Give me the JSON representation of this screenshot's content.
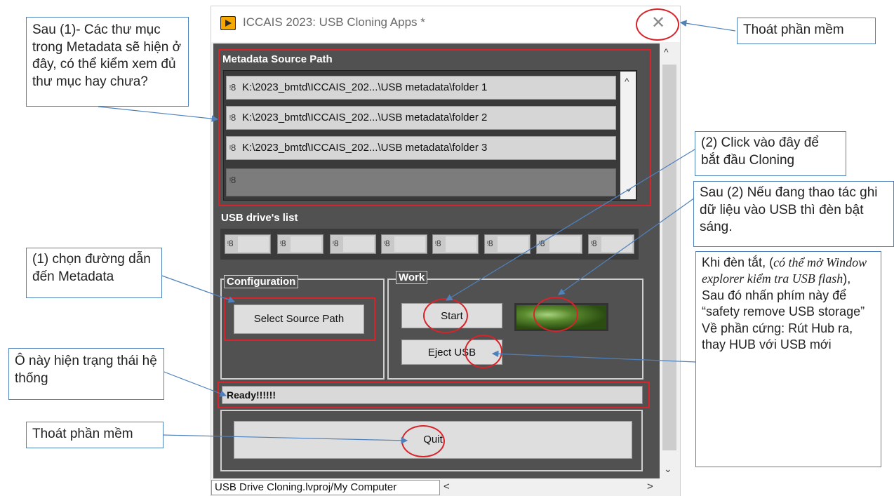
{
  "window": {
    "title": "ICCAIS 2023: USB Cloning Apps *",
    "close_glyph": "✕",
    "scroll_up": "^",
    "scroll_down": "⌄",
    "project_label": "USB Drive Cloning.lvproj/My Computer",
    "hscroll_left": "<",
    "hscroll_right": ">"
  },
  "metadata": {
    "label": "Metadata Source Path",
    "paths": [
      "K:\\2023_bmtd\\ICCAIS_202...\\USB metadata\\folder 1",
      "K:\\2023_bmtd\\ICCAIS_202...\\USB metadata\\folder 2",
      "K:\\2023_bmtd\\ICCAIS_202...\\USB metadata\\folder 3",
      ""
    ],
    "path_icon": "path-icon",
    "path_glyph": "ᵎ8"
  },
  "usb": {
    "label": "USB drive's list",
    "slot_count": 8,
    "slot_glyph": "ᵎ8"
  },
  "configuration": {
    "legend": "Configuration",
    "select_button": "Select Source Path"
  },
  "work": {
    "legend": "Work",
    "start_button": "Start",
    "eject_button": "Eject USB",
    "led_state": "on"
  },
  "status": {
    "text": "Ready!!!!!!"
  },
  "quit": {
    "label": "Quit"
  },
  "callouts": {
    "after1": "Sau (1)- Các thư mục trong Metadata sẽ hiện ở đây, có thể kiểm xem đủ thư mục hay chưa?",
    "exit_top": "Thoát phần mềm",
    "click_start": "(2) Click vào đây để bắt đầu Cloning",
    "after2": "Sau (2) Nếu đang thao tác ghi dữ liệu vào USB thì đèn bật sáng.",
    "choose_path": "(1)  chọn đường dẫn đến Metadata",
    "led_off_before": "Khi đèn tắt, (",
    "led_off_italic": "có thể mở Window explorer kiểm tra USB flash",
    "led_off_after": "), Sau đó nhấn phím này để  “safety remove USB storage” Về phần cứng: Rút Hub ra, thay HUB với USB mới",
    "status_box": "Ô này hiện  trạng thái hệ thống",
    "exit_bottom": "Thoát phần mềm"
  },
  "colors": {
    "panel": "#515151",
    "highlight_red": "#d9232a",
    "callout_border": "#4f81bd",
    "led_green": "#5a8a2e"
  }
}
